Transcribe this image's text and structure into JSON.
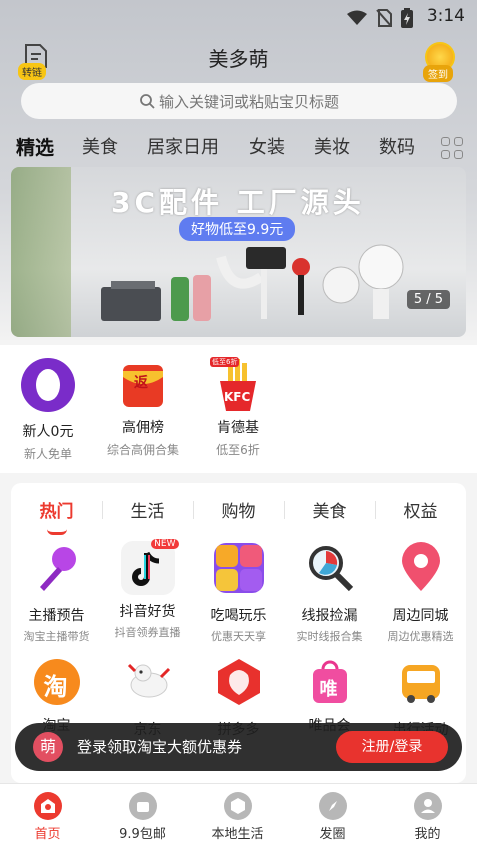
{
  "status_bar": {
    "time": "3:14"
  },
  "header": {
    "title": "美多萌",
    "convert_badge": "转链",
    "signin_badge": "签到"
  },
  "search": {
    "placeholder": "输入关键词或粘贴宝贝标题"
  },
  "categories": [
    "精选",
    "美食",
    "居家日用",
    "女装",
    "美妆",
    "数码"
  ],
  "banner": {
    "title": "3C配件 工厂源头",
    "subtitle": "好物低至9.9元",
    "counter": "5 / 5"
  },
  "quick_entries": [
    {
      "label": "新人0元",
      "sub": "新人免单",
      "icon": "new-user-icon"
    },
    {
      "label": "高佣榜",
      "sub": "综合高佣合集",
      "icon": "red-envelope-icon",
      "icon_text": "返"
    },
    {
      "label": "肯德基",
      "sub": "低至6折",
      "icon": "kfc-icon",
      "icon_text": "KFC",
      "icon_badge": "低至6折"
    }
  ],
  "channel_tabs": [
    "热门",
    "生活",
    "购物",
    "美食",
    "权益"
  ],
  "channels_row1": [
    {
      "label": "主播预告",
      "sub": "淘宝主播带货",
      "icon": "microphone-icon"
    },
    {
      "label": "抖音好货",
      "sub": "抖音领券直播",
      "icon": "douyin-icon",
      "badge": "NEW"
    },
    {
      "label": "吃喝玩乐",
      "sub": "优惠天天享",
      "icon": "food-fun-icon"
    },
    {
      "label": "线报捡漏",
      "sub": "实时线报合集",
      "icon": "magnifier-chart-icon"
    },
    {
      "label": "周边同城",
      "sub": "周边优惠精选",
      "icon": "location-pin-icon"
    }
  ],
  "channels_row2": [
    {
      "label": "淘宝",
      "icon": "taobao-icon",
      "icon_text": "淘"
    },
    {
      "label": "京东",
      "icon": "jd-dog-icon"
    },
    {
      "label": "拼多多",
      "icon": "pinduoduo-icon"
    },
    {
      "label": "唯品会",
      "icon": "vip-bag-icon",
      "icon_text": "唯"
    },
    {
      "label": "出行活动",
      "icon": "bus-icon"
    }
  ],
  "login_toast": {
    "text": "登录领取淘宝大额优惠券",
    "button": "注册/登录",
    "logo_text": "萌"
  },
  "bottom_nav": [
    {
      "label": "首页",
      "icon": "home-icon",
      "active": true
    },
    {
      "label": "9.9包邮",
      "icon": "bag-icon",
      "active": false
    },
    {
      "label": "本地生活",
      "icon": "shield-icon",
      "active": false
    },
    {
      "label": "发圈",
      "icon": "compass-icon",
      "active": false
    },
    {
      "label": "我的",
      "icon": "profile-icon",
      "active": false
    }
  ],
  "colors": {
    "accent": "#ec3a2f",
    "banner_pill": "#5f7cf0",
    "signin_gold": "#f7c514"
  }
}
